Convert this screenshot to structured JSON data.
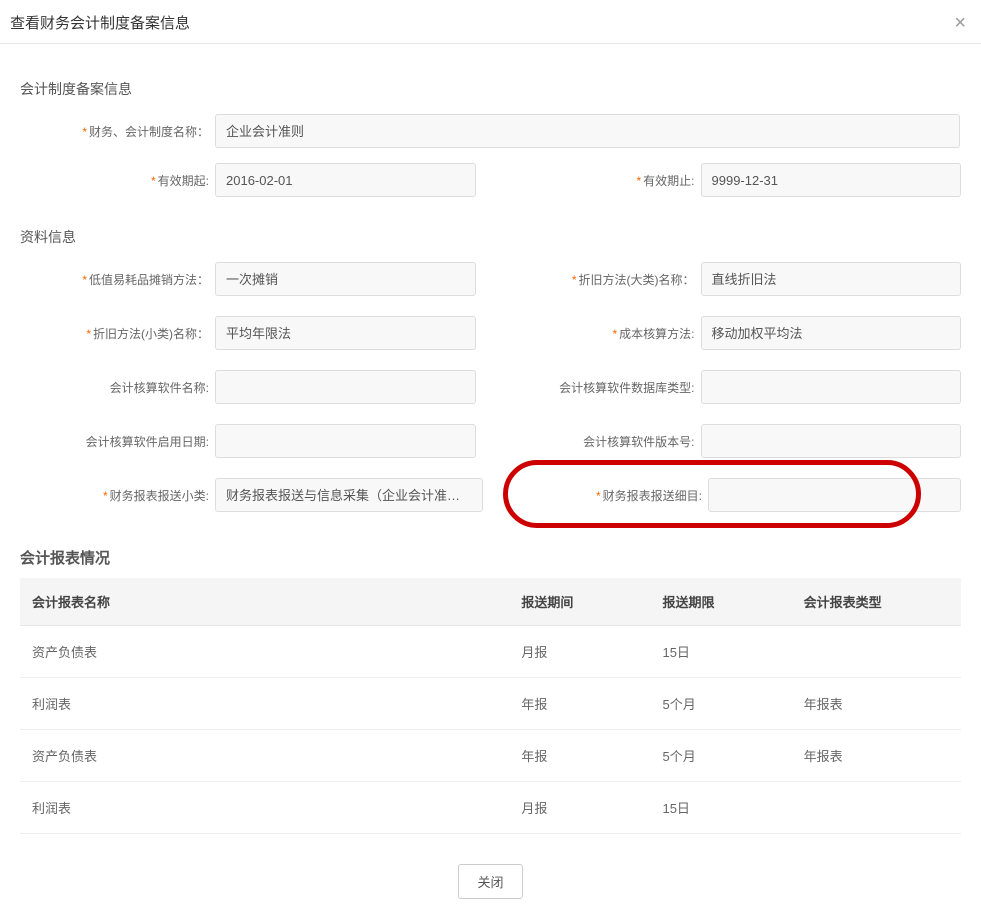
{
  "dialog": {
    "title": "查看财务会计制度备案信息",
    "close_button": "关闭"
  },
  "sections": {
    "filing_info": "会计制度备案信息",
    "material_info": "资料信息",
    "report_status": "会计报表情况"
  },
  "labels": {
    "accounting_system_name": "财务、会计制度名称：",
    "valid_from": "有效期起:",
    "valid_to": "有效期止:",
    "low_value_amort_method": "低值易耗品摊销方法：",
    "depreciation_major_name": "折旧方法(大类)名称：",
    "depreciation_minor_name": "折旧方法(小类)名称：",
    "cost_accounting_method": "成本核算方法:",
    "software_name": "会计核算软件名称:",
    "software_db_type": "会计核算软件数据库类型:",
    "software_enable_date": "会计核算软件启用日期:",
    "software_version": "会计核算软件版本号:",
    "report_submit_subclass": "财务报表报送小类:",
    "report_submit_detail": "财务报表报送细目:"
  },
  "values": {
    "accounting_system_name": "企业会计准则",
    "valid_from": "2016-02-01",
    "valid_to": "9999-12-31",
    "low_value_amort_method": "一次摊销",
    "depreciation_major_name": "直线折旧法",
    "depreciation_minor_name": "平均年限法",
    "cost_accounting_method": "移动加权平均法",
    "software_name": "",
    "software_db_type": "",
    "software_enable_date": "",
    "software_version": "",
    "report_submit_subclass": "财务报表报送与信息采集（企业会计准则一般企业）",
    "report_submit_detail": ""
  },
  "table": {
    "headers": {
      "name": "会计报表名称",
      "period": "报送期间",
      "deadline": "报送期限",
      "type": "会计报表类型"
    },
    "rows": [
      {
        "name": "资产负债表",
        "period": "月报",
        "deadline": "15日",
        "type": ""
      },
      {
        "name": "利润表",
        "period": "年报",
        "deadline": "5个月",
        "type": "年报表"
      },
      {
        "name": "资产负债表",
        "period": "年报",
        "deadline": "5个月",
        "type": "年报表"
      },
      {
        "name": "利润表",
        "period": "月报",
        "deadline": "15日",
        "type": ""
      }
    ]
  }
}
